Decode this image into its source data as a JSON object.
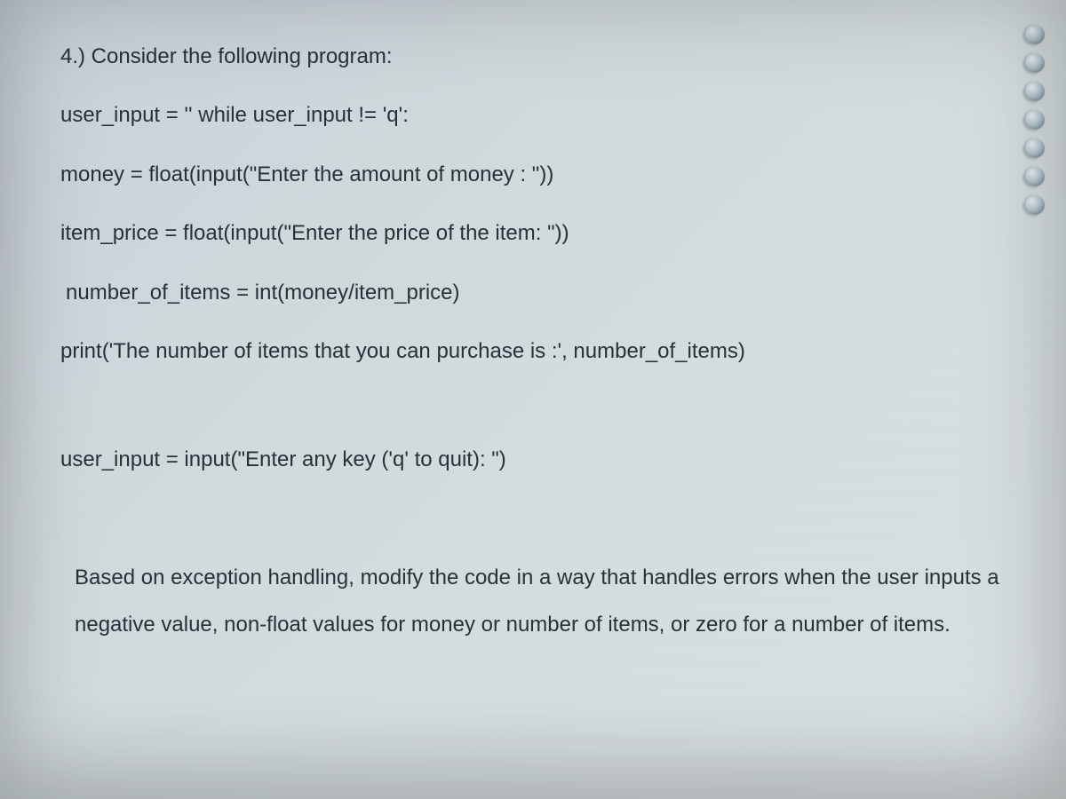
{
  "question": {
    "heading": "4.) Consider the following program:",
    "code_lines": [
      "user_input = '' while user_input != 'q':",
      "money = float(input(\"Enter the amount of money : \"))",
      "item_price = float(input(\"Enter the price of the item: \"))",
      "number_of_items = int(money/item_price)",
      "print('The number of items that you can purchase is :', number_of_items)",
      "user_input = input(\"Enter any key ('q' to quit): \")"
    ],
    "prompt": "Based on exception handling, modify the code in a way that handles errors when the user inputs a negative value, non-float values for money or number of items, or zero for a number of items."
  }
}
